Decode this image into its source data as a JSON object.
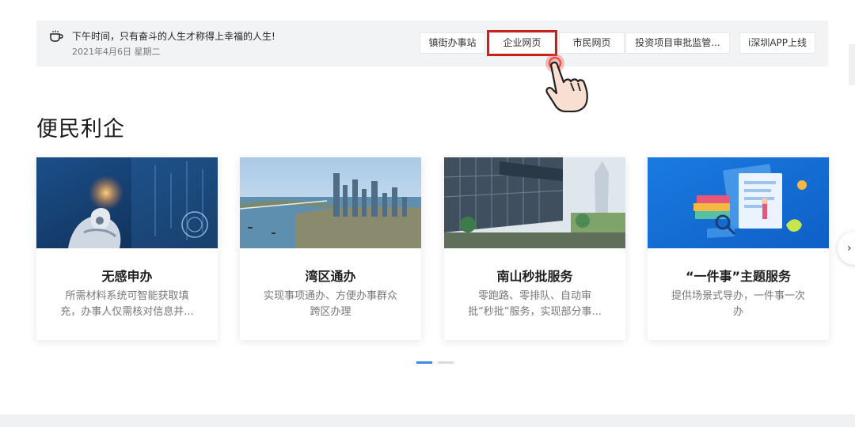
{
  "topbar": {
    "greeting": "下午时间，只有奋斗的人生才称得上幸福的人生!",
    "date": "2021年4月6日 星期二",
    "links": [
      {
        "label": "镇街办事站"
      },
      {
        "label": "企业网页"
      },
      {
        "label": "市民网页"
      },
      {
        "label": "投资项目审批监管..."
      },
      {
        "label": "i深圳APP上线"
      }
    ]
  },
  "section": {
    "title": "便民利企"
  },
  "cards": [
    {
      "title": "无感申办",
      "desc": "所需材料系统可智能获取填充，办事人仅需核对信息并..."
    },
    {
      "title": "湾区通办",
      "desc": "实现事项通办、方便办事群众跨区办理"
    },
    {
      "title": "南山秒批服务",
      "desc": "零跑路、零排队、自动审批“秒批”服务，实现部分事..."
    },
    {
      "title": "“一件事”主题服务",
      "desc": "提供场景式导办，一件事一次办"
    }
  ],
  "carousel": {
    "next_glyph": "›",
    "active_page": 1,
    "page_count": 2
  },
  "colors": {
    "accent": "#3d8be8",
    "highlight": "#c8221a",
    "topbar_bg": "#f2f3f5"
  }
}
